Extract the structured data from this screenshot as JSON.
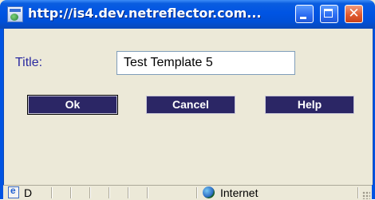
{
  "window": {
    "title": "http://is4.dev.netreflector.com..."
  },
  "form": {
    "title_label": "Title:",
    "title_value": "Test Template 5"
  },
  "buttons": {
    "ok": "Ok",
    "cancel": "Cancel",
    "help": "Help"
  },
  "statusbar": {
    "status_text": "D",
    "zone_label": "Internet"
  },
  "colors": {
    "titlebar": "#0054e3",
    "button_bg": "#2b2665",
    "label_text": "#2a2aa0",
    "window_bg": "#ece9d8"
  },
  "icons": {
    "window_icon": "ie-page-icon",
    "minimize": "minimize-icon",
    "maximize": "maximize-icon",
    "close": "close-icon",
    "status_page": "ie-page-icon",
    "zone": "globe-icon"
  }
}
